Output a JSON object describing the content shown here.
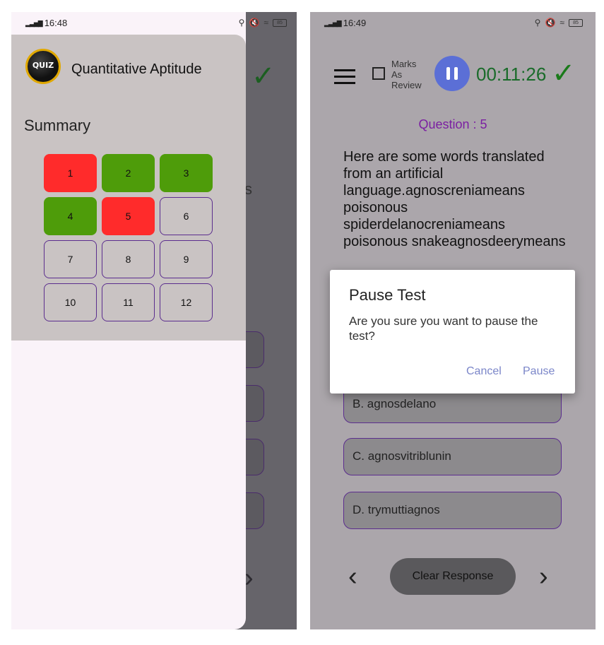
{
  "left_screen": {
    "status": {
      "time": "16:48",
      "battery": "85"
    },
    "drawer": {
      "app_logo_text": "QUIZ",
      "title": "Quantitative Aptitude",
      "summary_label": "Summary",
      "questions": [
        {
          "label": "1",
          "state": "wrong"
        },
        {
          "label": "2",
          "state": "correct"
        },
        {
          "label": "3",
          "state": "correct"
        },
        {
          "label": "4",
          "state": "correct"
        },
        {
          "label": "5",
          "state": "wrong"
        },
        {
          "label": "6",
          "state": "unanswered"
        },
        {
          "label": "7",
          "state": "unanswered"
        },
        {
          "label": "8",
          "state": "unanswered"
        },
        {
          "label": "9",
          "state": "unanswered"
        },
        {
          "label": "10",
          "state": "unanswered"
        },
        {
          "label": "11",
          "state": "unanswered"
        },
        {
          "label": "12",
          "state": "unanswered"
        }
      ],
      "colors": {
        "wrong": "#ff2b2b",
        "correct": "#4e9c0a",
        "unanswered_border": "#5b2d8e"
      }
    },
    "background": {
      "partial_text": "s",
      "next_icon": "chevron-right-icon"
    }
  },
  "right_screen": {
    "status": {
      "time": "16:49",
      "battery": "85"
    },
    "header": {
      "menu_icon": "hamburger-menu-icon",
      "mark_label": "Marks\nAs\nReview",
      "pause_icon": "pause-icon",
      "timer": "00:11:26",
      "submit_icon": "checkmark-icon"
    },
    "question_number": "Question : 5",
    "question_text": "Here are some words translated from an artificial language.agnoscreniameans poisonous spiderdelanocreniameans poisonous snakeagnosdeerymeans",
    "options": [
      {
        "label": "B. agnosdelano"
      },
      {
        "label": "C. agnosvitriblunin"
      },
      {
        "label": "D. trymuttiagnos"
      }
    ],
    "footer": {
      "clear_label": "Clear Response"
    },
    "dialog": {
      "title": "Pause Test",
      "message": "Are you sure you want to pause the test?",
      "cancel_label": "Cancel",
      "pause_label": "Pause"
    }
  }
}
